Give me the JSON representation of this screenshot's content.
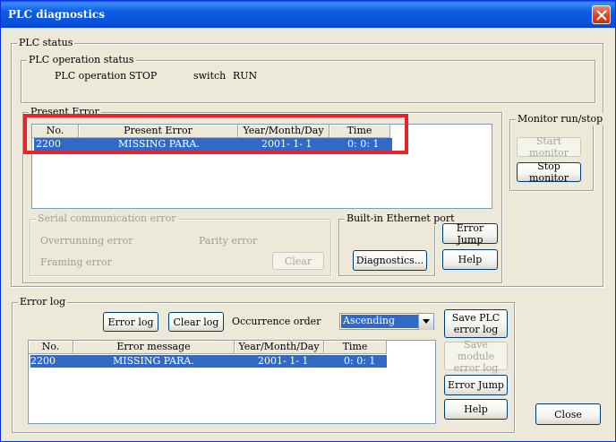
{
  "window": {
    "title": "PLC diagnostics"
  },
  "plc_status": {
    "label": "PLC status",
    "operation_status": {
      "label": "PLC operation status",
      "operation_label": "PLC operation",
      "operation_value": "STOP",
      "switch_label": "switch",
      "switch_value": "RUN"
    }
  },
  "present_error": {
    "label": "Present Error",
    "columns": [
      "No.",
      "Present Error",
      "Year/Month/Day",
      "Time"
    ],
    "rows": [
      {
        "no": "2200",
        "error": "MISSING PARA.",
        "date": "2001- 1- 1",
        "time": "0: 0: 1"
      }
    ]
  },
  "monitor": {
    "label": "Monitor run/stop",
    "start_label": "Start monitor",
    "stop_label": "Stop monitor"
  },
  "serial": {
    "label": "Serial communication error",
    "overrunning": "Overrunning error",
    "parity": "Parity error",
    "framing": "Framing error",
    "clear_label": "Clear"
  },
  "ethernet": {
    "label": "Built-in Ethernet port",
    "diagnostics_label": "Diagnostics..."
  },
  "present_actions": {
    "error_jump_label": "Error Jump",
    "help_label": "Help"
  },
  "error_log": {
    "label": "Error log",
    "error_log_button": "Error log",
    "clear_log_button": "Clear log",
    "occurrence_label": "Occurrence order",
    "occurrence_value": "Ascending",
    "columns": [
      "No.",
      "Error message",
      "Year/Month/Day",
      "Time"
    ],
    "rows": [
      {
        "no": "2200",
        "message": "MISSING PARA.",
        "date": "2001- 1- 1",
        "time": "0: 0: 1"
      }
    ],
    "save_plc_line1": "Save PLC",
    "save_plc_line2": "error log",
    "save_module_line1": "Save module",
    "save_module_line2": "error log",
    "error_jump_label": "Error Jump",
    "help_label": "Help"
  },
  "close_label": "Close",
  "colors": {
    "highlight": "#e52328",
    "selection": "#316ac5",
    "title_bar": "#0a5ee8"
  }
}
